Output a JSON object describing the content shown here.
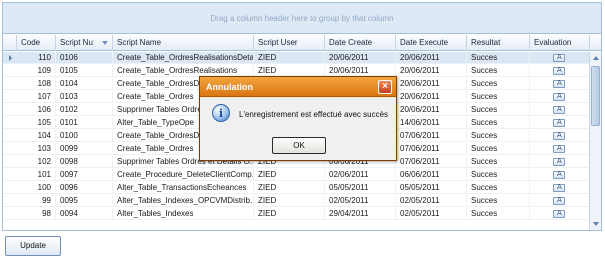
{
  "grid": {
    "group_panel_text": "Drag a column header here to group by that column",
    "columns": [
      "Code",
      "Script Nu",
      "Script Name",
      "Script User",
      "Date Create",
      "Date Execute",
      "Resultat",
      "Evaluation"
    ],
    "rows": [
      {
        "code": "110",
        "script_nu": "0106",
        "script_name": "Create_Table_OrdresRealisationsDetail",
        "script_user": "ZIED",
        "date_create": "20/06/2011",
        "date_execute": "20/06/2011",
        "resultat": "Succes"
      },
      {
        "code": "109",
        "script_nu": "0105",
        "script_name": "Create_Table_OrdresRealisations",
        "script_user": "ZIED",
        "date_create": "20/06/2011",
        "date_execute": "20/06/2011",
        "resultat": "Succes"
      },
      {
        "code": "108",
        "script_nu": "0104",
        "script_name": "Create_Table_OrdresDet",
        "script_user": "",
        "date_create": "",
        "date_execute": "20/06/2011",
        "resultat": "Succes"
      },
      {
        "code": "107",
        "script_nu": "0103",
        "script_name": "Create_Table_Ordres",
        "script_user": "",
        "date_create": "",
        "date_execute": "20/06/2011",
        "resultat": "Succes"
      },
      {
        "code": "106",
        "script_nu": "0102",
        "script_name": "Supprimer Tables Ordres",
        "script_user": "",
        "date_create": "",
        "date_execute": "20/06/2011",
        "resultat": "Succes"
      },
      {
        "code": "105",
        "script_nu": "0101",
        "script_name": "Alter_Table_TypeOpe",
        "script_user": "",
        "date_create": "",
        "date_execute": "14/06/2011",
        "resultat": "Succes"
      },
      {
        "code": "104",
        "script_nu": "0100",
        "script_name": "Create_Table_OrdresDet",
        "script_user": "",
        "date_create": "",
        "date_execute": "07/06/2011",
        "resultat": "Succes"
      },
      {
        "code": "103",
        "script_nu": "0099",
        "script_name": "Create_Table_Ordres",
        "script_user": "",
        "date_create": "",
        "date_execute": "07/06/2011",
        "resultat": "Succes"
      },
      {
        "code": "102",
        "script_nu": "0098",
        "script_name": "Supprimer Tables Ordres et Details O...",
        "script_user": "ZIED",
        "date_create": "06/06/2011",
        "date_execute": "07/06/2011",
        "resultat": "Succes"
      },
      {
        "code": "101",
        "script_nu": "0097",
        "script_name": "Create_Procedure_DeleteClientComp...",
        "script_user": "ZIED",
        "date_create": "02/06/2011",
        "date_execute": "06/06/2011",
        "resultat": "Succes"
      },
      {
        "code": "100",
        "script_nu": "0096",
        "script_name": "Alter_Table_TransactionsEcheances",
        "script_user": "ZIED",
        "date_create": "05/05/2011",
        "date_execute": "05/05/2011",
        "resultat": "Succes"
      },
      {
        "code": "99",
        "script_nu": "0095",
        "script_name": "Alter_Tables_Indexes_OPCVMDistrib...",
        "script_user": "ZIED",
        "date_create": "02/05/2011",
        "date_execute": "02/05/2011",
        "resultat": "Succes"
      },
      {
        "code": "98",
        "script_nu": "0094",
        "script_name": "Alter_Tables_Indexes",
        "script_user": "ZIED",
        "date_create": "29/04/2011",
        "date_execute": "02/05/2011",
        "resultat": "Succes"
      }
    ]
  },
  "update_button_label": "Update",
  "dialog": {
    "title": "Annulation",
    "message": "L'enregistrement est effectué avec succès",
    "ok_label": "OK",
    "close_symbol": "×",
    "icon_letter": "i"
  }
}
